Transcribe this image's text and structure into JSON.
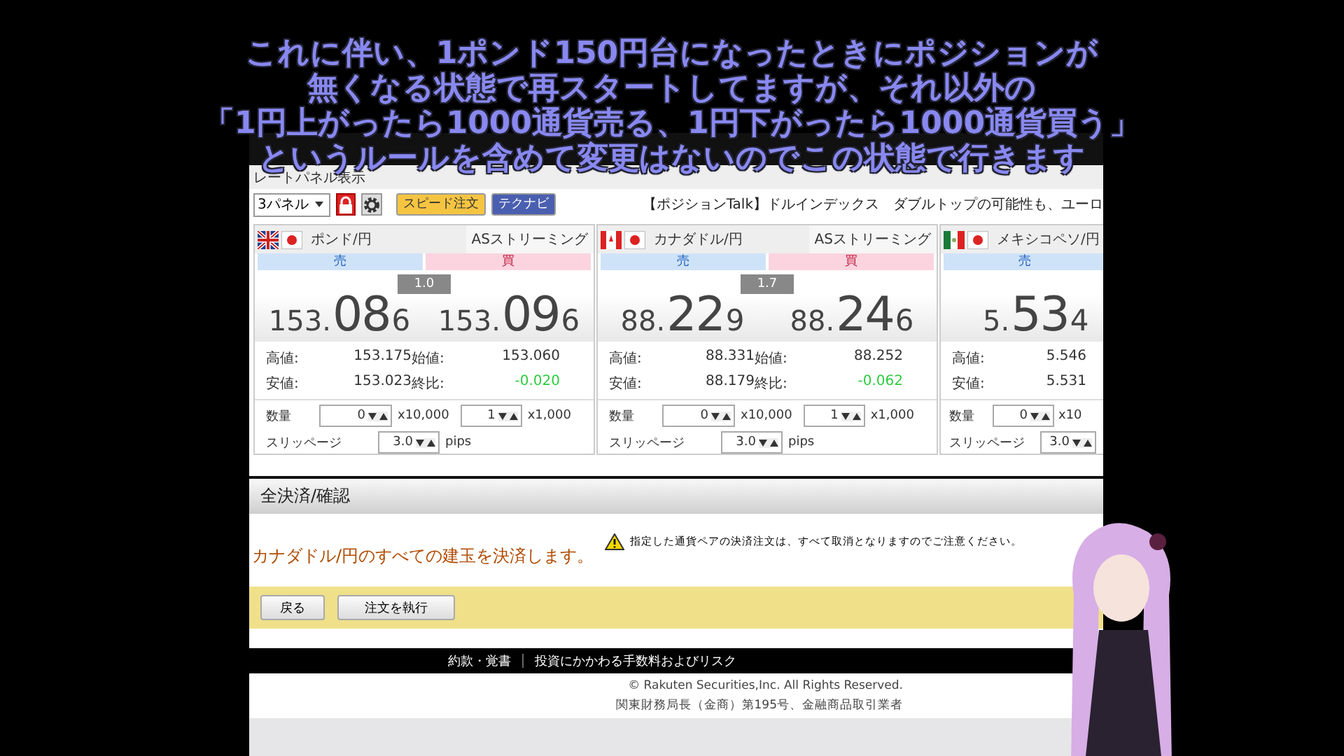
{
  "subtitle": [
    "これに伴い、1ポンド150円台になったときにポジションが",
    "無くなる状態で再スタートしてますが、それ以外の",
    "「1円上がったら1000通貨売る、1円下がったら1000通貨買う」",
    "というルールを含めて変更はないのでこの状態で行きます"
  ],
  "toolbar": {
    "panel_label": "レートパネル表示",
    "select": "3パネル",
    "speed_button": "スピード注文",
    "technavi_button": "テクナビ",
    "news": "【ポジションTalk】ドルインデックス　ダブルトップの可能性も、ユーロ"
  },
  "panels": [
    {
      "kind": "gb",
      "pair": "ポンド/円",
      "feed": "ASストリーミング",
      "sell_label": "売",
      "buy_label": "買",
      "spread": "1.0",
      "bid": [
        "153.",
        "08",
        "6"
      ],
      "ask": [
        "153.",
        "09",
        "6"
      ],
      "high_label": "高値:",
      "high": "153.175",
      "open_label": "始値:",
      "open": "153.060",
      "low_label": "安値:",
      "low": "153.023",
      "change_label": "終比:",
      "change": "-0.020",
      "qty_label": "数量",
      "qty1": "0",
      "unit1": "x10,000",
      "qty2": "1",
      "unit2": "x1,000",
      "slip_label": "スリッページ",
      "slip": "3.0",
      "slip_unit": "pips"
    },
    {
      "kind": "ca",
      "pair": "カナダドル/円",
      "feed": "ASストリーミング",
      "sell_label": "売",
      "buy_label": "買",
      "spread": "1.7",
      "bid": [
        "88.",
        "22",
        "9"
      ],
      "ask": [
        "88.",
        "24",
        "6"
      ],
      "high_label": "高値:",
      "high": "88.331",
      "open_label": "始値:",
      "open": "88.252",
      "low_label": "安値:",
      "low": "88.179",
      "change_label": "終比:",
      "change": "-0.062",
      "qty_label": "数量",
      "qty1": "0",
      "unit1": "x10,000",
      "qty2": "1",
      "unit2": "x1,000",
      "slip_label": "スリッページ",
      "slip": "3.0",
      "slip_unit": "pips"
    },
    {
      "kind": "mx",
      "pair": "メキシコペソ/円",
      "sell_label": "売",
      "bid": [
        "5.",
        "53",
        "4"
      ],
      "high_label": "高値:",
      "high": "5.546",
      "low_label": "安値:",
      "low": "5.531",
      "qty_label": "数量",
      "qty1": "0",
      "unit1": "x10",
      "slip_label": "スリッページ",
      "slip": "3.0"
    }
  ],
  "confirm": {
    "title": "全決済/確認",
    "message": "カナダドル/円のすべての建玉を決済します。",
    "warning": "指定した通貨ペアの決済注文は、すべて取消となりますのでご注意ください。",
    "buttons": [
      "戻る",
      "注文を執行"
    ]
  },
  "footer": {
    "links": [
      "約款・覚書",
      "投資にかかわる手数料およびリスク"
    ],
    "copyright": "© Rakuten Securities,Inc. All Rights Reserved.",
    "registration": "関東財務局長（金商）第195号、金融商品取引業者"
  }
}
